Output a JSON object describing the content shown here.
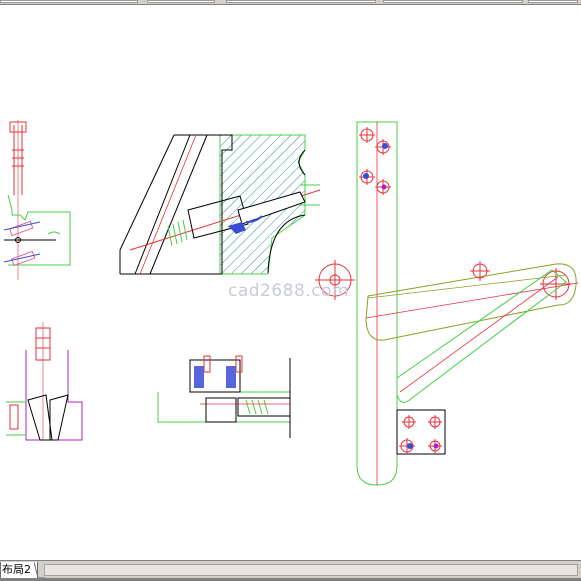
{
  "watermark": "cad2688.com",
  "layout_tab": "布局2",
  "colors": {
    "red": "#e8313a",
    "green": "#44d044",
    "black": "#000000",
    "blue": "#3a4bd6",
    "magenta": "#b020c0",
    "hatch": "#2a8fa8",
    "olive": "#8aa020",
    "pink": "#e060a0"
  }
}
